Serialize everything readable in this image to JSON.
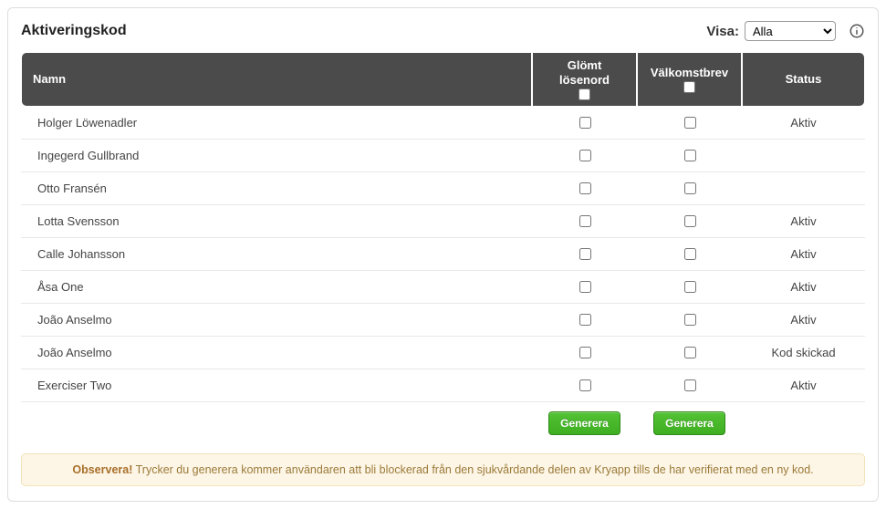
{
  "header": {
    "title": "Aktiveringskod",
    "visa_label": "Visa:",
    "visa_selected": "Alla",
    "visa_options": [
      "Alla"
    ]
  },
  "table": {
    "columns": {
      "name": "Namn",
      "forgot_password": "Glömt lösenord",
      "welcome_letter": "Välkomstbrev",
      "status": "Status"
    },
    "rows": [
      {
        "name": "Holger Löwenadler",
        "status": "Aktiv"
      },
      {
        "name": "Ingegerd Gullbrand",
        "status": ""
      },
      {
        "name": "Otto Fransén",
        "status": ""
      },
      {
        "name": "Lotta Svensson",
        "status": "Aktiv"
      },
      {
        "name": "Calle Johansson",
        "status": "Aktiv"
      },
      {
        "name": "Åsa One",
        "status": "Aktiv"
      },
      {
        "name": "João Anselmo",
        "status": "Aktiv"
      },
      {
        "name": "João Anselmo",
        "status": "Kod skickad"
      },
      {
        "name": "Exerciser Two",
        "status": "Aktiv"
      }
    ],
    "generate_label": "Generera"
  },
  "alert": {
    "strong": "Observera!",
    "text": " Trycker du generera kommer användaren att bli blockerad från den sjukvårdande delen av Kryapp tills de har verifierat med en ny kod."
  }
}
